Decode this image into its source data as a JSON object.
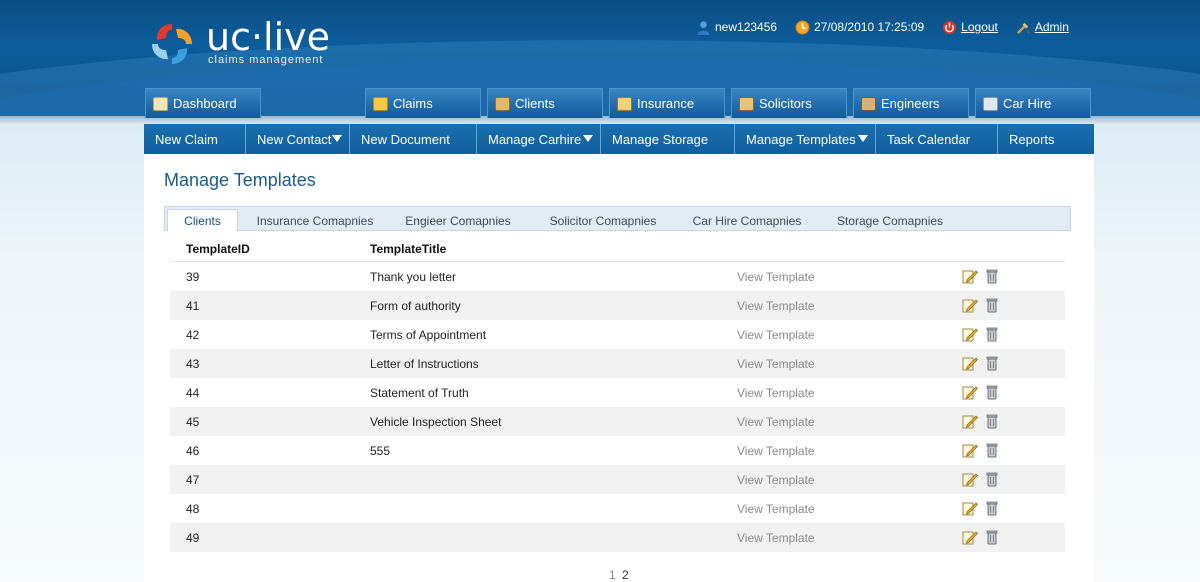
{
  "brand": {
    "name": "uc·live",
    "tagline": "claims management"
  },
  "userbar": {
    "username": "new123456",
    "datetime": "27/08/2010 17:25:09",
    "logout": "Logout",
    "admin": "Admin"
  },
  "main_tabs": [
    {
      "label": "Dashboard",
      "icon": "dashboard-icon"
    },
    {
      "label": "Claims",
      "icon": "claims-folder-icon"
    },
    {
      "label": "Clients",
      "icon": "clients-icon"
    },
    {
      "label": "Insurance",
      "icon": "insurance-icon"
    },
    {
      "label": "Solicitors",
      "icon": "solicitors-icon"
    },
    {
      "label": "Engineers",
      "icon": "engineers-icon"
    },
    {
      "label": "Car Hire",
      "icon": "car-icon"
    }
  ],
  "sub_nav": [
    {
      "label": "New Claim",
      "dropdown": false
    },
    {
      "label": "New Contact",
      "dropdown": true
    },
    {
      "label": "New Document",
      "dropdown": false
    },
    {
      "label": "Manage Carhire",
      "dropdown": true
    },
    {
      "label": "Manage Storage",
      "dropdown": false
    },
    {
      "label": "Manage Templates",
      "dropdown": true
    },
    {
      "label": "Task Calendar",
      "dropdown": false
    },
    {
      "label": "Reports",
      "dropdown": false
    }
  ],
  "page_title": "Manage Templates",
  "content_tabs": [
    {
      "label": "Clients",
      "active": true
    },
    {
      "label": "Insurance Comapnies",
      "active": false
    },
    {
      "label": "Engieer Comapnies",
      "active": false
    },
    {
      "label": "Solicitor Comapnies",
      "active": false
    },
    {
      "label": "Car Hire Comapnies",
      "active": false
    },
    {
      "label": "Storage Comapnies",
      "active": false
    }
  ],
  "table": {
    "headers": [
      "TemplateID",
      "TemplateTitle"
    ],
    "rows": [
      {
        "id": "39",
        "title": "Thank you letter",
        "view": "View Template"
      },
      {
        "id": "41",
        "title": "Form of authority",
        "view": "View Template"
      },
      {
        "id": "42",
        "title": "Terms of Appointment",
        "view": "View Template"
      },
      {
        "id": "43",
        "title": "Letter of Instructions",
        "view": "View Template"
      },
      {
        "id": "44",
        "title": "Statement of Truth",
        "view": "View Template"
      },
      {
        "id": "45",
        "title": "Vehicle Inspection Sheet",
        "view": "View Template"
      },
      {
        "id": "46",
        "title": "555",
        "view": "View Template"
      },
      {
        "id": "47",
        "title": "",
        "view": "View Template"
      },
      {
        "id": "48",
        "title": "",
        "view": "View Template"
      },
      {
        "id": "49",
        "title": "",
        "view": "View Template"
      }
    ]
  },
  "pager": {
    "pages": [
      "1",
      "2"
    ],
    "current": "1"
  },
  "colors": {
    "header": "#0c5d9c",
    "subnav": "#1b6fae",
    "title": "#1c5a8a",
    "logout_icon": "#d9342b",
    "clock_icon": "#f0a830"
  }
}
